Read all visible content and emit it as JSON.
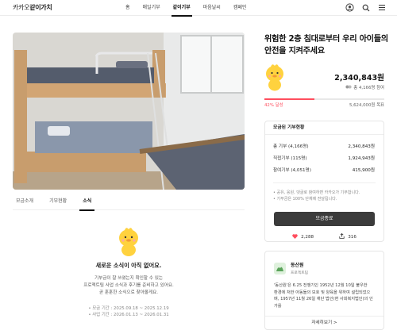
{
  "brand": {
    "prefix": "카카오",
    "name": "같이가치"
  },
  "nav": [
    {
      "label": "홈",
      "active": false
    },
    {
      "label": "매일기부",
      "active": false
    },
    {
      "label": "같이기부",
      "active": true
    },
    {
      "label": "마음날씨",
      "active": false
    },
    {
      "label": "캠페인",
      "active": false
    }
  ],
  "header_icons": [
    "profile-icon",
    "search-icon",
    "menu-icon"
  ],
  "tabs": [
    {
      "label": "모금소개",
      "active": false
    },
    {
      "label": "기부현황",
      "active": false
    },
    {
      "label": "소식",
      "active": true
    }
  ],
  "news": {
    "empty_title": "새로운 소식이 아직 없어요.",
    "desc_lines": [
      "기부금이 잘 쓰였는지 확인할 수 있는",
      "프로젝트팀 사업 소식과 후기를 준비하고 있어요.",
      "곧 훈훈한 소식으로 찾아올게요."
    ],
    "period_lines": [
      "• 모금 기간 : 2025.09.18 ~ 2025.12.19",
      "• 사업 기간 : 2026.01.13 ~ 2026.01.31"
    ]
  },
  "campaign": {
    "title": "위험한 2층 침대로부터 우리 아이들의 안전을 지켜주세요",
    "amount": "2,340,843원",
    "donors": "총 4,166명 참여",
    "progress_percent": 42,
    "progress_label": "42% 달성",
    "goal": "5,624,000원 목표"
  },
  "donation_status": {
    "heading": "모금된 기부현황",
    "rows": [
      {
        "label": "총 기부 (4,166명)",
        "value": "2,340,843원"
      },
      {
        "label": "직접기부 (115명)",
        "value": "1,924,943원"
      },
      {
        "label": "참여기부 (4,051명)",
        "value": "415,900원"
      }
    ],
    "notes": [
      "• 공유, 응원, 댓글로 참여하면 카카오가 기부합니다.",
      "• 기부금은 100% 단체에 전달됩니다."
    ],
    "button": "모금종료",
    "likes": "2,288",
    "shares": "316"
  },
  "org": {
    "name": "동산원",
    "role": "프로젝트팀",
    "desc_lines": [
      "'동산원'은 6.25 전쟁기인 1952년 12월 10일 불우한",
      "환경에 처한 아동들의 보호 및 양육을 위하여 설립되었으",
      "며, 1957년 11월 26일 재단 법인(현 사회복지법인)의 인가를"
    ],
    "more": "자세히보기 >"
  },
  "colors": {
    "accent": "#ff4e5e",
    "button": "#3b3b3b"
  }
}
